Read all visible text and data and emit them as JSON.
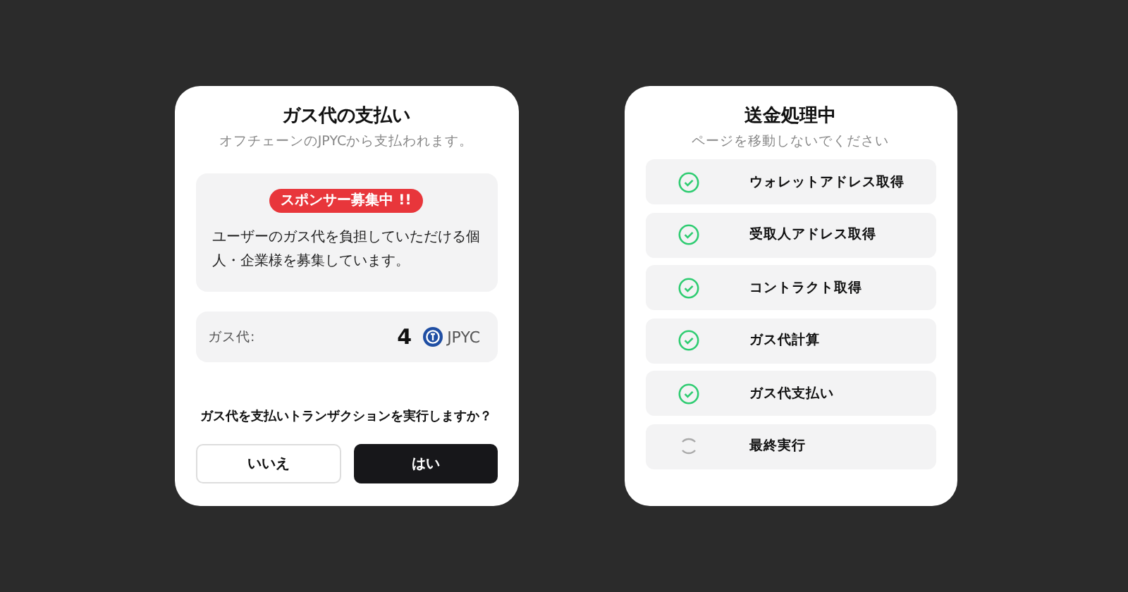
{
  "payment_card": {
    "title": "ガス代の支払い",
    "subtitle": "オフチェーンのJPYCから支払われます。",
    "sponsor": {
      "badge": "スポンサー募集中 !!",
      "message": "ユーザーのガス代を負担していただける個人・企業様を募集しています。"
    },
    "fee": {
      "label": "ガス代:",
      "amount": "4",
      "currency": "JPYC"
    },
    "question": "ガス代を支払いトランザクションを実行しますか？",
    "buttons": [
      {
        "label": "いいえ",
        "kind": "secondary"
      },
      {
        "label": "はい",
        "kind": "primary"
      }
    ]
  },
  "progress_card": {
    "title": "送金処理中",
    "subtitle": "ページを移動しないでください",
    "steps": [
      {
        "label": "ウォレットアドレス取得",
        "done": true
      },
      {
        "label": "受取人アドレス取得",
        "done": true
      },
      {
        "label": "コントラクト取得",
        "done": true
      },
      {
        "label": "ガス代計算",
        "done": true
      },
      {
        "label": "ガス代支払い",
        "done": true
      },
      {
        "label": "最終実行",
        "done": false
      }
    ]
  }
}
